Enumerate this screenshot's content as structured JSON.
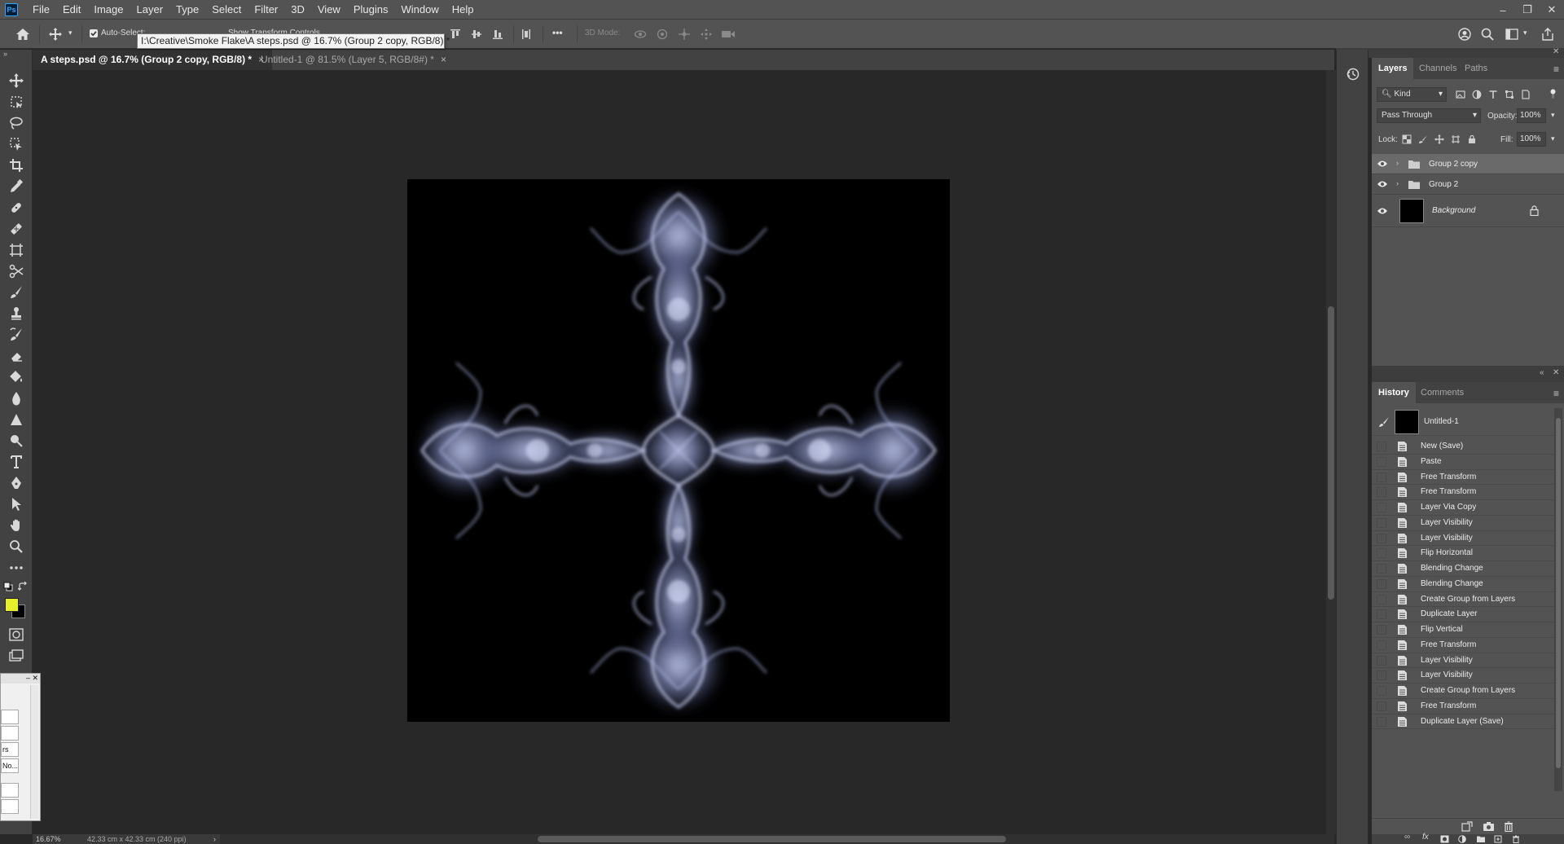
{
  "app": {
    "logo_text": "Ps",
    "menu": [
      "File",
      "Edit",
      "Image",
      "Layer",
      "Type",
      "Select",
      "Filter",
      "3D",
      "View",
      "Plugins",
      "Window",
      "Help"
    ],
    "window_controls": {
      "minimize": "–",
      "restore": "❐",
      "close": "✕"
    }
  },
  "options_bar": {
    "auto_select_label": "Auto-Select:",
    "show_transform_label": "Show Transform Controls",
    "three_d_mode_label": "3D Mode:",
    "more_label": "•••"
  },
  "tooltip": "I:\\Creative\\Smoke Flake\\A steps.psd @ 16.7% (Group 2 copy, RGB/8) *",
  "tabs": [
    {
      "label": "A steps.psd @ 16.7% (Group 2 copy, RGB/8) *",
      "active": true
    },
    {
      "label": "Untitled-1 @ 81.5% (Layer 5, RGB/8#) *",
      "active": false
    }
  ],
  "tab_close": "×",
  "status": {
    "zoom": "16.67%",
    "doc_size": "42.33 cm x 42.33 cm (240 ppi)",
    "arrow": "›"
  },
  "layers_panel": {
    "tabs": [
      "Layers",
      "Channels",
      "Paths"
    ],
    "filter_label": "Kind",
    "blend_mode": "Pass Through",
    "opacity_label": "Opacity:",
    "opacity_value": "100%",
    "lock_label": "Lock:",
    "fill_label": "Fill:",
    "fill_value": "100%",
    "layers": [
      {
        "name": "Group 2 copy",
        "type": "group",
        "selected": true
      },
      {
        "name": "Group 2",
        "type": "group",
        "selected": false
      },
      {
        "name": "Background",
        "type": "background",
        "selected": false
      }
    ]
  },
  "history_panel": {
    "tabs": [
      "History",
      "Comments"
    ],
    "snapshot": "Untitled-1",
    "states": [
      "New (Save)",
      "Paste",
      "Free Transform",
      "Free Transform",
      "Layer Via Copy",
      "Layer Visibility",
      "Layer Visibility",
      "Flip Horizontal",
      "Blending Change",
      "Blending Change",
      "Create Group from Layers",
      "Duplicate Layer",
      "Flip Vertical",
      "Free Transform",
      "Layer Visibility",
      "Layer Visibility",
      "Create Group from Layers",
      "Free Transform",
      "Duplicate Layer (Save)"
    ]
  },
  "mini_panel": {
    "rows": [
      "",
      "",
      "rs",
      "No...",
      "",
      ""
    ]
  },
  "colors": {
    "foreground": "#e6f02a",
    "background": "#000000",
    "smoke": "#aab4e6"
  }
}
